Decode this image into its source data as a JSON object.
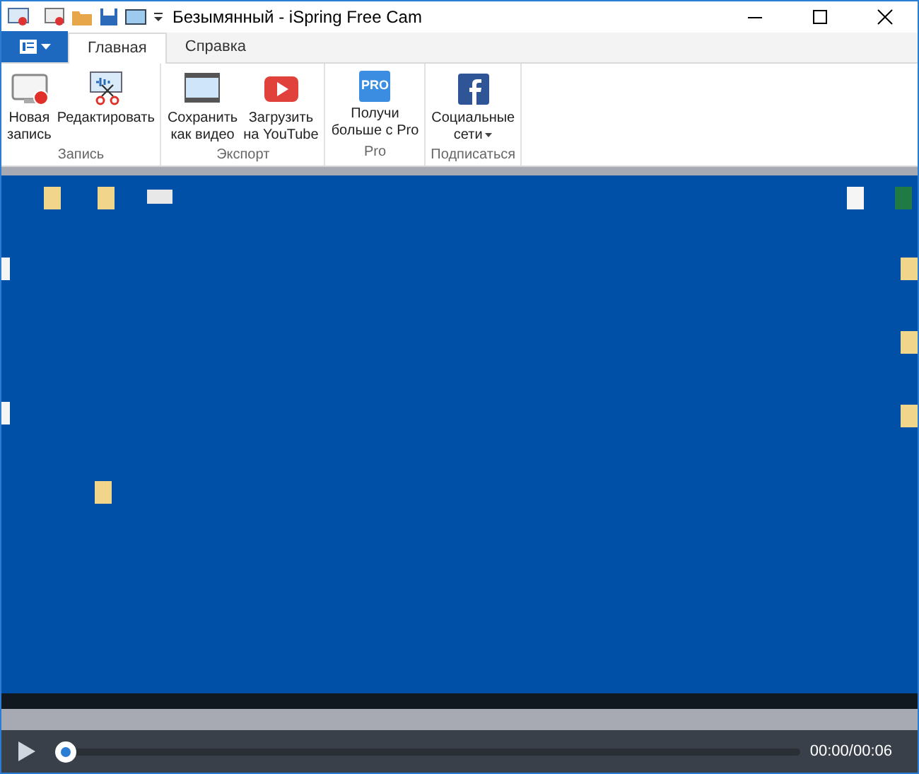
{
  "window": {
    "title": "Безымянный - iSpring Free Cam"
  },
  "tabs": [
    {
      "label": "Главная",
      "selected": true
    },
    {
      "label": "Справка",
      "selected": false
    }
  ],
  "ribbon_groups": [
    {
      "label": "Запись",
      "buttons": [
        {
          "kind": "record",
          "label": "Новая\nзапись"
        },
        {
          "kind": "edit",
          "label": "Редактировать"
        }
      ]
    },
    {
      "label": "Экспорт",
      "buttons": [
        {
          "kind": "film",
          "label": "Сохранить\nкак видео"
        },
        {
          "kind": "youtube",
          "label": "Загрузить\nна YouTube"
        }
      ]
    },
    {
      "label": "Pro",
      "buttons": [
        {
          "kind": "pro",
          "label": "Получи\nбольше с Pro",
          "icon_text": "PRO"
        }
      ]
    },
    {
      "label": "Подписаться",
      "buttons": [
        {
          "kind": "social",
          "label": "Социальные\nсети",
          "dropdown": true
        }
      ]
    }
  ],
  "player": {
    "playing": false,
    "level": 0,
    "time": "00:00/00:06"
  }
}
